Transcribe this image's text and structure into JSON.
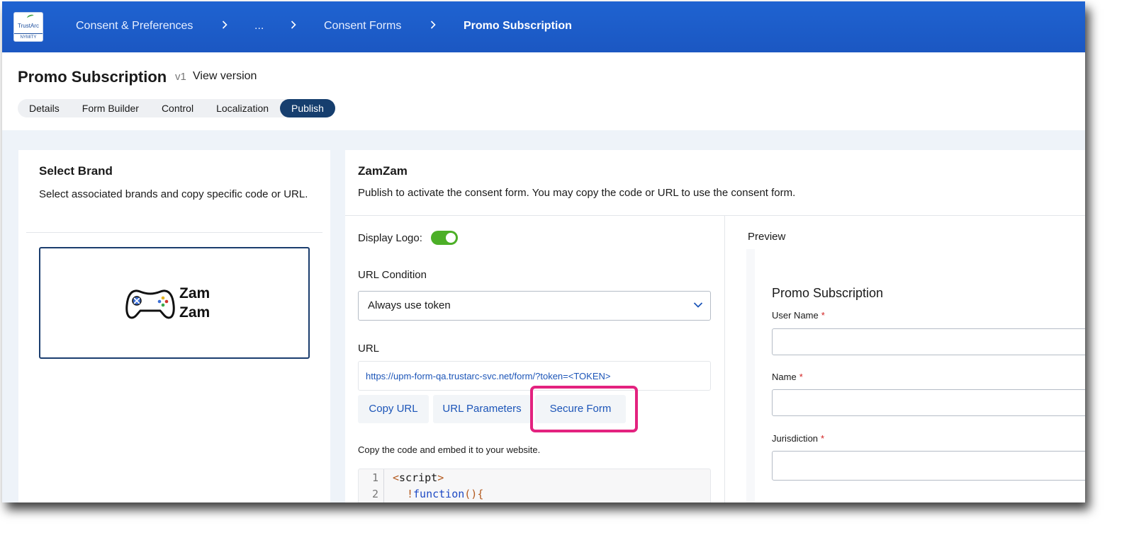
{
  "header": {
    "logo_text": "TrustArc",
    "logo_subtext": "NYMITY",
    "breadcrumbs": [
      "Consent & Preferences",
      "...",
      "Consent Forms",
      "Promo Subscription"
    ]
  },
  "page": {
    "title": "Promo Subscription",
    "version": "v1",
    "view_version_label": "View version",
    "tabs": [
      "Details",
      "Form Builder",
      "Control",
      "Localization",
      "Publish"
    ],
    "active_tab": "Publish"
  },
  "left_panel": {
    "title": "Select Brand",
    "description": "Select associated brands and copy specific code or URL.",
    "brand": {
      "name_line1": "Zam",
      "name_line2": "Zam",
      "icon": "gamepad-icon"
    }
  },
  "right_panel": {
    "title": "ZamZam",
    "description": "Publish to activate the consent form. You may copy the code or URL to use the consent form.",
    "display_logo_label": "Display Logo:",
    "display_logo_on": true,
    "url_condition_label": "URL Condition",
    "url_condition_value": "Always use token",
    "url_label": "URL",
    "url_value": "https://upm-form-qa.trustarc-svc.net/form/?token=<TOKEN>",
    "buttons": {
      "copy_url": "Copy URL",
      "url_parameters": "URL Parameters",
      "secure_form": "Secure Form"
    },
    "embed_label": "Copy the code and embed it to your website.",
    "code": {
      "line_numbers": [
        "1",
        "2"
      ],
      "line1": {
        "open": "<",
        "tag": "script",
        "close": ">"
      },
      "line2": {
        "bang": "!",
        "keyword": "function",
        "rest": "(){"
      }
    }
  },
  "preview": {
    "label": "Preview",
    "form_title": "Promo Subscription",
    "required_mark": "*",
    "fields": [
      "User Name",
      "Name",
      "Jurisdiction"
    ]
  },
  "colors": {
    "header_blue": "#1f63d1",
    "active_tab": "#163e6e",
    "link_blue": "#1c55b8",
    "toggle_green": "#4caf27",
    "highlight_pink": "#e3227f",
    "required_red": "#d21f1f"
  }
}
